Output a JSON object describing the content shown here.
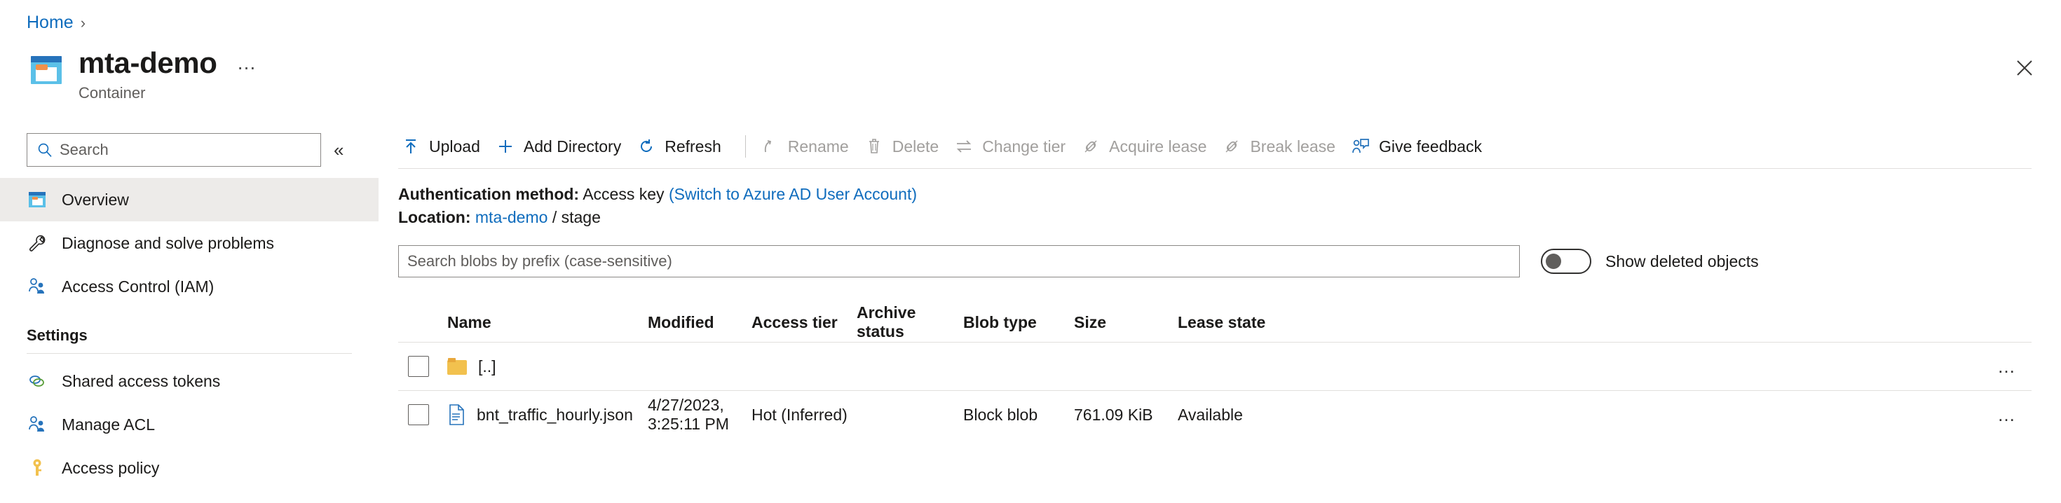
{
  "breadcrumb": {
    "home": "Home",
    "separator": "›"
  },
  "header": {
    "title": "mta-demo",
    "subtitle": "Container",
    "ellipsis": "…",
    "close_label": "Close"
  },
  "nav": {
    "search_placeholder": "Search",
    "collapse": "«",
    "items": [
      {
        "label": "Overview",
        "icon": "container-icon",
        "active": true
      },
      {
        "label": "Diagnose and solve problems",
        "icon": "wrench-icon",
        "active": false
      },
      {
        "label": "Access Control (IAM)",
        "icon": "people-icon",
        "active": false
      }
    ],
    "section_title": "Settings",
    "settings_items": [
      {
        "label": "Shared access tokens",
        "icon": "link-rings-icon"
      },
      {
        "label": "Manage ACL",
        "icon": "people-icon"
      },
      {
        "label": "Access policy",
        "icon": "key-icon"
      }
    ]
  },
  "toolbar": {
    "buttons": [
      {
        "label": "Upload",
        "icon": "upload-icon",
        "disabled": false
      },
      {
        "label": "Add Directory",
        "icon": "plus-icon",
        "disabled": false
      },
      {
        "label": "Refresh",
        "icon": "refresh-icon",
        "disabled": false
      },
      {
        "label": "Rename",
        "icon": "rename-icon",
        "disabled": true
      },
      {
        "label": "Delete",
        "icon": "trash-icon",
        "disabled": true
      },
      {
        "label": "Change tier",
        "icon": "swap-icon",
        "disabled": true
      },
      {
        "label": "Acquire lease",
        "icon": "lease-icon",
        "disabled": true
      },
      {
        "label": "Break lease",
        "icon": "lease-icon",
        "disabled": true
      },
      {
        "label": "Give feedback",
        "icon": "feedback-icon",
        "disabled": false
      }
    ]
  },
  "meta": {
    "auth_label": "Authentication method:",
    "auth_value": "Access key",
    "auth_link": "(Switch to Azure AD User Account)",
    "location_label": "Location:",
    "location_container": "mta-demo",
    "location_sep": "/",
    "location_path": "stage"
  },
  "filter": {
    "search_placeholder": "Search blobs by prefix (case-sensitive)",
    "toggle_label": "Show deleted objects",
    "toggle_on": false
  },
  "table": {
    "columns": [
      "Name",
      "Modified",
      "Access tier",
      "Archive status",
      "Blob type",
      "Size",
      "Lease state"
    ],
    "rows": [
      {
        "icon": "folder-icon",
        "name": "[..]",
        "modified": "",
        "access_tier": "",
        "archive_status": "",
        "blob_type": "",
        "size": "",
        "lease_state": "",
        "more": "…"
      },
      {
        "icon": "json-file-icon",
        "name": "bnt_traffic_hourly.json",
        "modified": "4/27/2023, 3:25:11 PM",
        "access_tier": "Hot (Inferred)",
        "archive_status": "",
        "blob_type": "Block blob",
        "size": "761.09 KiB",
        "lease_state": "Available",
        "more": "…"
      }
    ]
  },
  "colors": {
    "link": "#0f6cbd",
    "accent": "#2673bb",
    "nav_active_bg": "#edebe9",
    "border": "#e1dfdd",
    "disabled_text": "#a19f9d"
  }
}
